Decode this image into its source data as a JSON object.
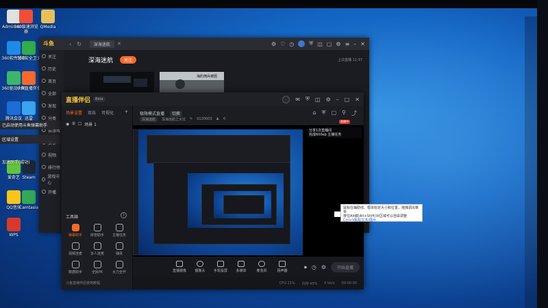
{
  "desktop": {
    "icons": [
      {
        "label": "Administr...",
        "color": "#e0e0e0"
      },
      {
        "label": "360极速浏览器",
        "color": "#f04d3b"
      },
      {
        "label": "QMedia",
        "color": "#e6c15a"
      },
      {
        "label": "360软件管家",
        "color": "#1f8ae6"
      },
      {
        "label": "360安全卫士",
        "color": "#2fae4a"
      },
      {
        "label": "360驱动大师",
        "color": "#3cb56b"
      },
      {
        "label": "斗鱼直播伴侣",
        "color": "#f56a2b"
      },
      {
        "label": "腾讯会议",
        "color": "#1c6dd6"
      },
      {
        "label": "迅雷",
        "color": "#3ba4ef"
      },
      {
        "label": "爱奇艺",
        "color": "#61c43b"
      },
      {
        "label": "Steam",
        "color": "#1b2838"
      },
      {
        "label": "QQ音乐",
        "color": "#f7c51b"
      },
      {
        "label": "Camtasia",
        "color": "#33a856"
      },
      {
        "label": "WPS",
        "color": "#d63a2b"
      }
    ],
    "callout_lines": [
      "已启动使用斗鱼弹幕助手",
      "区域设置",
      "加油助手(成功)"
    ]
  },
  "back_window": {
    "logo": "斗鱼",
    "tab_label": "深海迷航",
    "room_title": "深海迷航",
    "follow_label": "关注",
    "last_live": "上次直播 11:37",
    "sidebar_items": [
      "关注",
      "历史",
      "首页",
      "全部",
      "发现",
      "分类",
      "云游戏",
      "赛事",
      "视频",
      "排行榜",
      "游戏中心",
      "开播"
    ],
    "thumb_caption": "海豹佣兵被困"
  },
  "obs": {
    "brand": "直播伴侣",
    "version": "Beta",
    "scene_tabs": [
      "场景设置",
      "双击",
      "可视化"
    ],
    "scene_name": "场景 1",
    "tools_title": "工具箱",
    "tools": [
      {
        "label": "弹幕助手",
        "hot": true
      },
      {
        "label": "房管助手",
        "hot": false
      },
      {
        "label": "主播任务",
        "hot": false
      },
      {
        "label": "视频连麦",
        "hot": false
      },
      {
        "label": "多人连麦",
        "hot": false
      },
      {
        "label": "抽奖",
        "hot": false
      },
      {
        "label": "数据助手",
        "hot": false
      },
      {
        "label": "全民PK",
        "hot": false
      },
      {
        "label": "大力全开",
        "hot": false
      }
    ],
    "left_footer": "斗鱼直播伴侣使用教程",
    "room_mode": "极限模式直播",
    "room_mode_switch": "切换",
    "room_category": "深海迷航",
    "room_meta_title": "深海迷航之大坑",
    "room_id": "9120603",
    "room_fans": "6",
    "live_badge": "直播中",
    "overlay_lines": [
      "分享1次直播间",
      "完成600ep 主播任务"
    ],
    "bottom_buttons": [
      "直播摄像",
      "摄像头",
      "手机投屏",
      "多媒体",
      "麦克风",
      "扬声器"
    ],
    "go_live_label": "开始直播",
    "status_items": [
      "CPU 21%",
      "内存 45%",
      "0 kb/s",
      "00:00:00"
    ]
  },
  "tooltip": {
    "line1": "鼠标在辅助线、框体标定大小和位置，拖拽调出菜单",
    "line2": "按住Alt键(Alt+Shift)对区域可以自由调整",
    "line3_prefix": "",
    "line3_hl": "Ctrl+V粘贴文本/图片"
  }
}
